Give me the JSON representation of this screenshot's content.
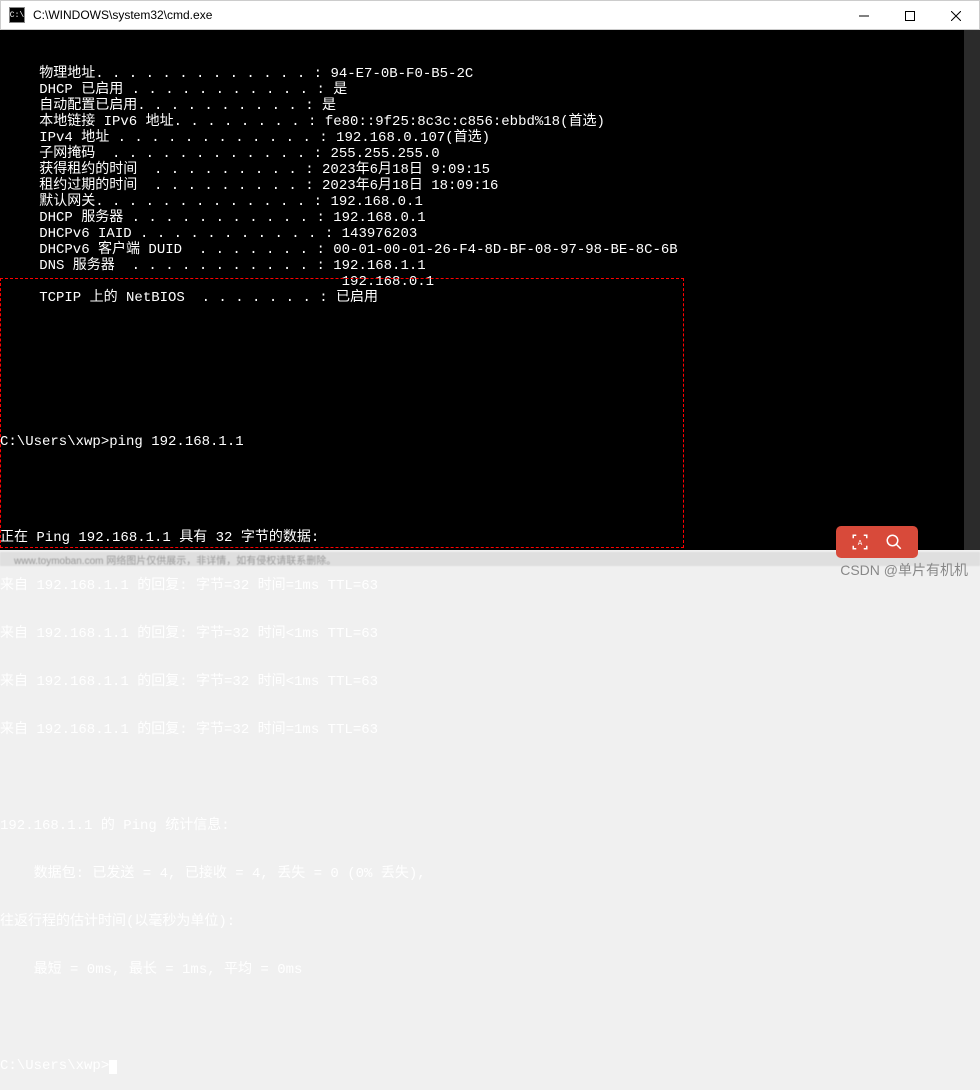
{
  "window": {
    "title": "C:\\WINDOWS\\system32\\cmd.exe",
    "icon_label": "cmd"
  },
  "ipconfig": {
    "lines": [
      {
        "label": "   物理地址. . . . . . . . . . . . . : ",
        "value": "94-E7-0B-F0-B5-2C"
      },
      {
        "label": "   DHCP 已启用 . . . . . . . . . . . : ",
        "value": "是"
      },
      {
        "label": "   自动配置已启用. . . . . . . . . . : ",
        "value": "是"
      },
      {
        "label": "   本地链接 IPv6 地址. . . . . . . . : ",
        "value": "fe80::9f25:8c3c:c856:ebbd%18(首选)"
      },
      {
        "label": "   IPv4 地址 . . . . . . . . . . . . : ",
        "value": "192.168.0.107(首选)"
      },
      {
        "label": "   子网掩码  . . . . . . . . . . . . : ",
        "value": "255.255.255.0"
      },
      {
        "label": "   获得租约的时间  . . . . . . . . . : ",
        "value": "2023年6月18日 9:09:15"
      },
      {
        "label": "   租约过期的时间  . . . . . . . . . : ",
        "value": "2023年6月18日 18:09:16"
      },
      {
        "label": "   默认网关. . . . . . . . . . . . . : ",
        "value": "192.168.0.1"
      },
      {
        "label": "   DHCP 服务器 . . . . . . . . . . . : ",
        "value": "192.168.0.1"
      },
      {
        "label": "   DHCPv6 IAID . . . . . . . . . . . : ",
        "value": "143976203"
      },
      {
        "label": "   DHCPv6 客户端 DUID  . . . . . . . : ",
        "value": "00-01-00-01-26-F4-8D-BF-08-97-98-BE-8C-6B"
      },
      {
        "label": "   DNS 服务器  . . . . . . . . . . . : ",
        "value": "192.168.1.1"
      },
      {
        "label": "                                       ",
        "value": "192.168.0.1"
      },
      {
        "label": "   TCPIP 上的 NetBIOS  . . . . . . . : ",
        "value": "已启用"
      }
    ]
  },
  "ping": {
    "prompt": "C:\\Users\\xwp>",
    "command": "ping 192.168.1.1",
    "header": "正在 Ping 192.168.1.1 具有 32 字节的数据:",
    "replies": [
      "来自 192.168.1.1 的回复: 字节=32 时间=1ms TTL=63",
      "来自 192.168.1.1 的回复: 字节=32 时间<1ms TTL=63",
      "来自 192.168.1.1 的回复: 字节=32 时间<1ms TTL=63",
      "来自 192.168.1.1 的回复: 字节=32 时间=1ms TTL=63"
    ],
    "stats_header": "192.168.1.1 的 Ping 统计信息:",
    "stats_packets": "    数据包: 已发送 = 4, 已接收 = 4, 丢失 = 0 (0% 丢失),",
    "rtt_header": "往返行程的估计时间(以毫秒为单位):",
    "rtt_values": "    最短 = 0ms, 最长 = 1ms, 平均 = 0ms",
    "final_prompt": "C:\\Users\\xwp>"
  },
  "footer": {
    "blur_text": "www.toymoban.com 网络图片仅供展示，非详情，如有侵权请联系删除。"
  },
  "watermark": {
    "text": "CSDN @单片有机机"
  }
}
